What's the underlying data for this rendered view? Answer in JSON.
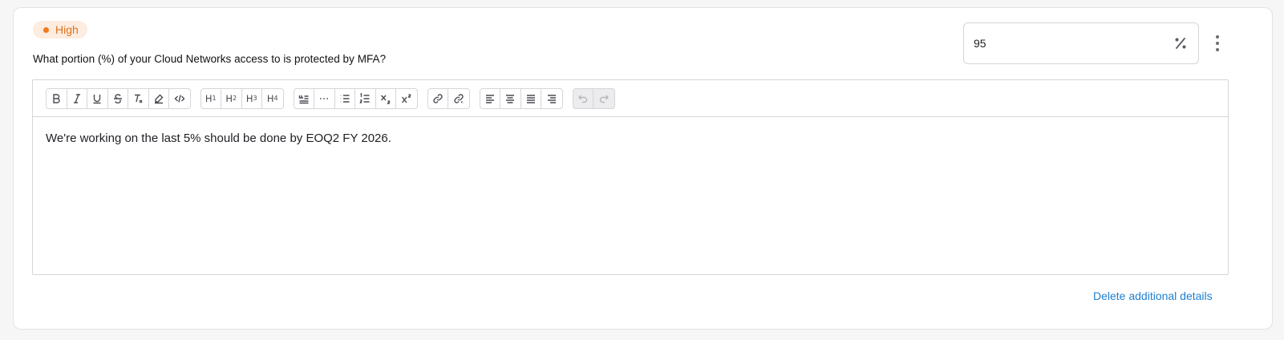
{
  "priority": {
    "label": "High",
    "color": "#e0721b",
    "dot_color": "#f07a1e",
    "background": "#fdece0"
  },
  "question": {
    "text": "What portion (%) of your Cloud Networks access to is protected by MFA?"
  },
  "answer": {
    "value": "95",
    "unit_icon": "percent-icon"
  },
  "more_menu": {
    "icon": "more-vertical-icon"
  },
  "editor": {
    "toolbar": {
      "format": [
        "bold-icon",
        "italic-icon",
        "underline-icon",
        "strikethrough-icon",
        "clear-format-icon",
        "highlight-icon",
        "code-icon"
      ],
      "headings": [
        {
          "h": "H",
          "n": "1"
        },
        {
          "h": "H",
          "n": "2"
        },
        {
          "h": "H",
          "n": "3"
        },
        {
          "h": "H",
          "n": "4"
        }
      ],
      "blocks": [
        "blockquote-icon",
        "horizontal-rule-icon",
        "bullet-list-icon",
        "ordered-list-icon",
        "subscript-icon",
        "superscript-icon"
      ],
      "links": [
        "link-icon",
        "unlink-icon"
      ],
      "align": [
        "align-left-icon",
        "align-center-icon",
        "align-justify-icon",
        "align-right-icon"
      ],
      "history": [
        "undo-icon",
        "redo-icon"
      ]
    },
    "content": "We're working on the last 5% should be done by EOQ2 FY 2026."
  },
  "actions": {
    "delete_label": "Delete additional details",
    "link_color": "#1e7fd0"
  }
}
